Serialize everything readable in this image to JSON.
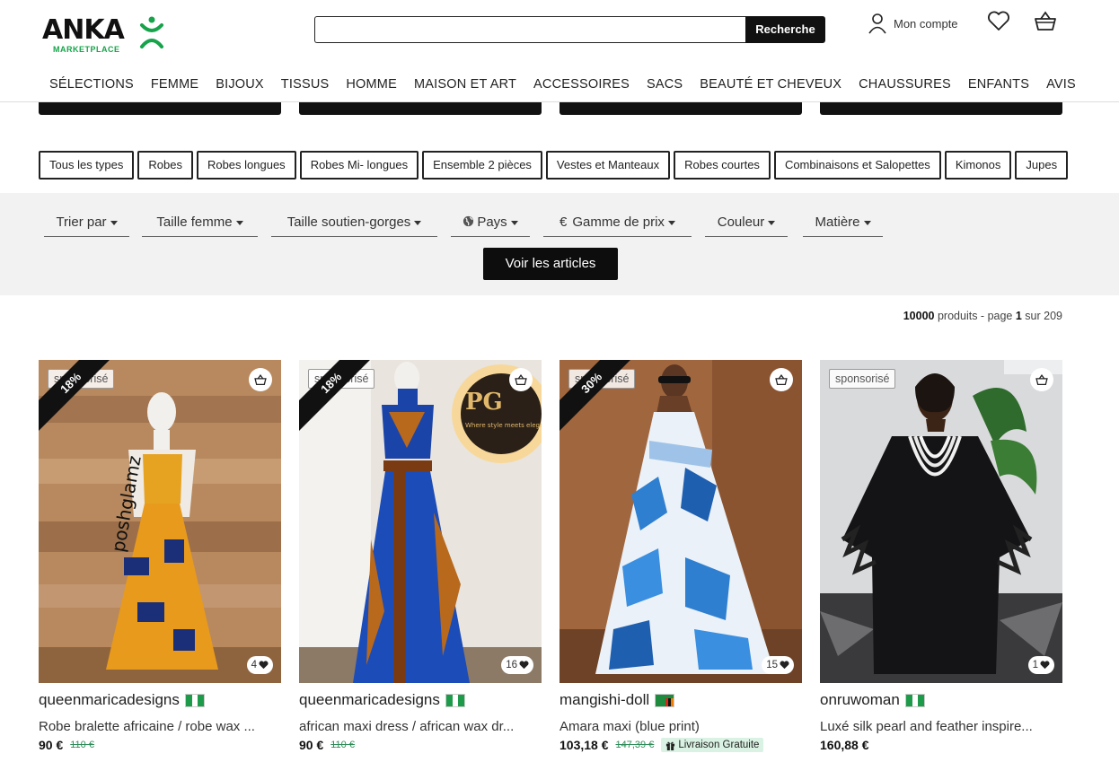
{
  "brand": {
    "name": "ANKA",
    "sub": "MARKETPLACE",
    "accent": "#16a34a"
  },
  "search": {
    "placeholder": "",
    "button": "Recherche"
  },
  "header": {
    "account": "Mon compte"
  },
  "nav": [
    "SÉLECTIONS",
    "FEMME",
    "BIJOUX",
    "TISSUS",
    "HOMME",
    "MAISON ET ART",
    "ACCESSOIRES",
    "SACS",
    "BEAUTÉ ET CHEVEUX",
    "CHAUSSURES",
    "ENFANTS",
    "AVIS"
  ],
  "types": [
    "Tous les types",
    "Robes",
    "Robes longues",
    "Robes Mi- longues",
    "Ensemble 2 pièces",
    "Vestes et Manteaux",
    "Robes courtes",
    "Combinaisons et Salopettes",
    "Kimonos",
    "Jupes"
  ],
  "filters": {
    "sort": "Trier par",
    "size": "Taille femme",
    "bra": "Taille soutien-gorges",
    "country": "Pays",
    "price": "Gamme de prix",
    "color": "Couleur",
    "material": "Matière",
    "submit": "Voir les articles"
  },
  "results": {
    "count": "10000",
    "label": "produits - page",
    "page": "1",
    "of": "sur 209"
  },
  "products": [
    {
      "discount": "18%",
      "sponsor": "sponsorisé",
      "likes": "4",
      "seller": "queenmaricadesigns",
      "flag": "Nigeria",
      "title": "Robe bralette africaine / robe wax ...",
      "price": "90 €",
      "old_price": "110 €",
      "free_shipping": ""
    },
    {
      "discount": "18%",
      "sponsor": "sponsorisé",
      "likes": "16",
      "seller": "queenmaricadesigns",
      "flag": "Nigeria",
      "title": "african maxi dress / african wax dr...",
      "price": "90 €",
      "old_price": "110 €",
      "free_shipping": ""
    },
    {
      "discount": "30%",
      "sponsor": "sponsorisé",
      "likes": "15",
      "seller": "mangishi-doll",
      "flag": "Zambia",
      "title": "Amara maxi (blue print)",
      "price": "103,18 €",
      "old_price": "147,39 €",
      "free_shipping": "Livraison Gratuite"
    },
    {
      "discount": "",
      "sponsor": "sponsorisé",
      "likes": "1",
      "seller": "onruwoman",
      "flag": "Nigeria",
      "title": "Luxé silk pearl and feather inspire...",
      "price": "160,88 €",
      "old_price": "",
      "free_shipping": ""
    }
  ]
}
